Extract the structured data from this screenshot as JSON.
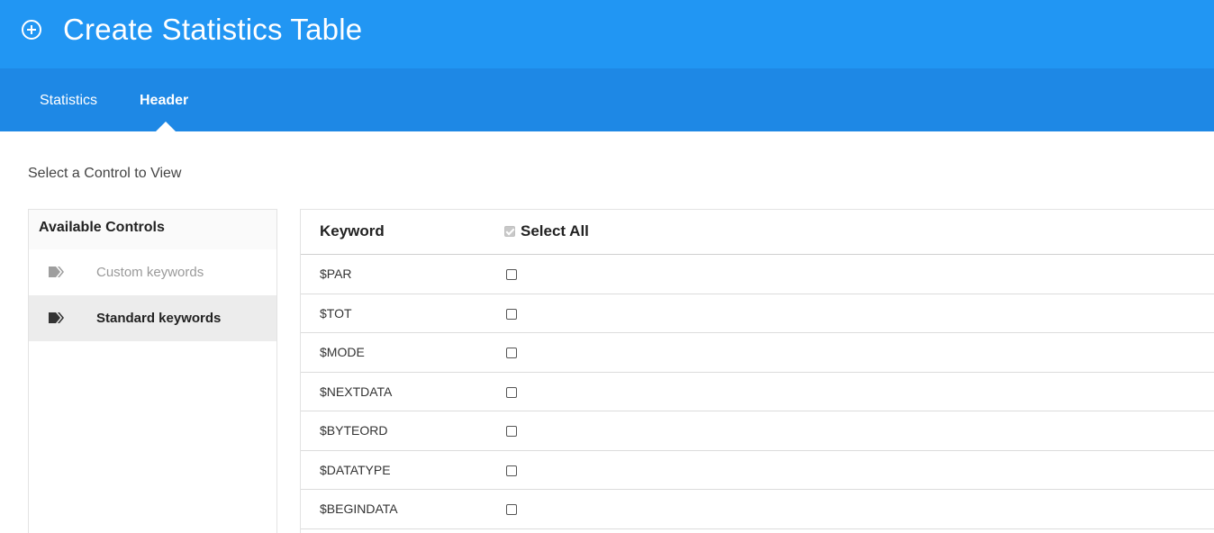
{
  "window": {
    "title": "Create Statistics Table"
  },
  "tabs": [
    {
      "label": "Statistics"
    },
    {
      "label": "Header"
    }
  ],
  "subtitle": "Select a Control to View",
  "controls": {
    "heading": "Available Controls",
    "items": [
      {
        "label": "Custom keywords",
        "icon": "tags-icon"
      },
      {
        "label": "Standard keywords",
        "icon": "tags-icon"
      }
    ]
  },
  "table": {
    "column_keyword": "Keyword",
    "select_all": "Select All",
    "rows": [
      {
        "keyword": "$PAR"
      },
      {
        "keyword": "$TOT"
      },
      {
        "keyword": "$MODE"
      },
      {
        "keyword": "$NEXTDATA"
      },
      {
        "keyword": "$BYTEORD"
      },
      {
        "keyword": "$DATATYPE"
      },
      {
        "keyword": "$BEGINDATA"
      }
    ]
  },
  "colors": {
    "title_bar": "#2196f3",
    "tab_bar": "#1e88e5"
  }
}
